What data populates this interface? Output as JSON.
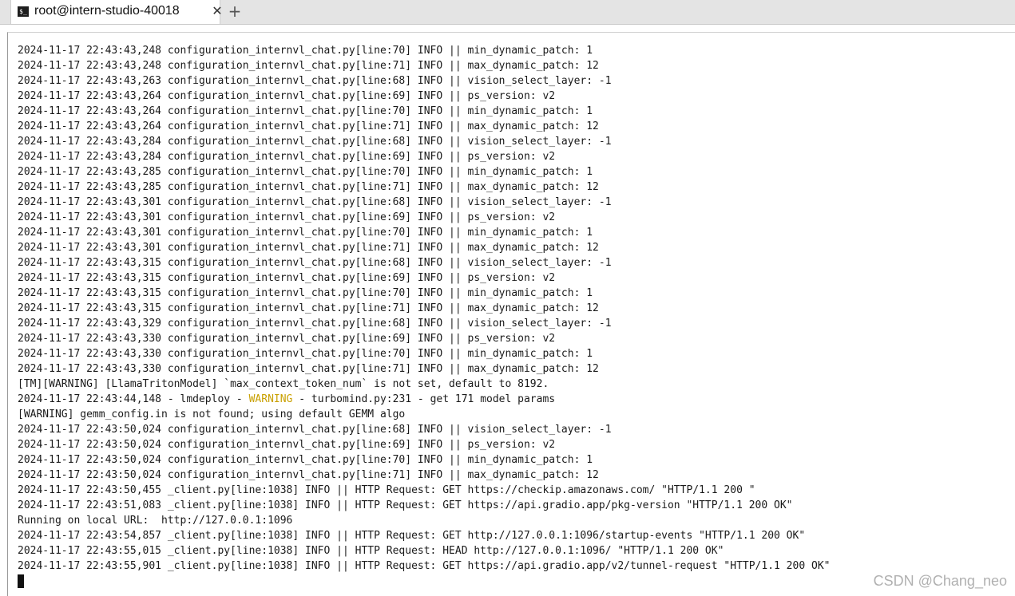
{
  "tab": {
    "icon_text": "$_",
    "title": "root@intern-studio-40018",
    "close_glyph": "✕",
    "new_tab_glyph": "+"
  },
  "colors": {
    "warning": "#c9a000"
  },
  "terminal": {
    "lines": [
      "2024-11-17 22:43:43,248 configuration_internvl_chat.py[line:70] INFO || min_dynamic_patch: 1",
      "2024-11-17 22:43:43,248 configuration_internvl_chat.py[line:71] INFO || max_dynamic_patch: 12",
      "2024-11-17 22:43:43,263 configuration_internvl_chat.py[line:68] INFO || vision_select_layer: -1",
      "2024-11-17 22:43:43,264 configuration_internvl_chat.py[line:69] INFO || ps_version: v2",
      "2024-11-17 22:43:43,264 configuration_internvl_chat.py[line:70] INFO || min_dynamic_patch: 1",
      "2024-11-17 22:43:43,264 configuration_internvl_chat.py[line:71] INFO || max_dynamic_patch: 12",
      "2024-11-17 22:43:43,284 configuration_internvl_chat.py[line:68] INFO || vision_select_layer: -1",
      "2024-11-17 22:43:43,284 configuration_internvl_chat.py[line:69] INFO || ps_version: v2",
      "2024-11-17 22:43:43,285 configuration_internvl_chat.py[line:70] INFO || min_dynamic_patch: 1",
      "2024-11-17 22:43:43,285 configuration_internvl_chat.py[line:71] INFO || max_dynamic_patch: 12",
      "2024-11-17 22:43:43,301 configuration_internvl_chat.py[line:68] INFO || vision_select_layer: -1",
      "2024-11-17 22:43:43,301 configuration_internvl_chat.py[line:69] INFO || ps_version: v2",
      "2024-11-17 22:43:43,301 configuration_internvl_chat.py[line:70] INFO || min_dynamic_patch: 1",
      "2024-11-17 22:43:43,301 configuration_internvl_chat.py[line:71] INFO || max_dynamic_patch: 12",
      "2024-11-17 22:43:43,315 configuration_internvl_chat.py[line:68] INFO || vision_select_layer: -1",
      "2024-11-17 22:43:43,315 configuration_internvl_chat.py[line:69] INFO || ps_version: v2",
      "2024-11-17 22:43:43,315 configuration_internvl_chat.py[line:70] INFO || min_dynamic_patch: 1",
      "2024-11-17 22:43:43,315 configuration_internvl_chat.py[line:71] INFO || max_dynamic_patch: 12",
      "2024-11-17 22:43:43,329 configuration_internvl_chat.py[line:68] INFO || vision_select_layer: -1",
      "2024-11-17 22:43:43,330 configuration_internvl_chat.py[line:69] INFO || ps_version: v2",
      "2024-11-17 22:43:43,330 configuration_internvl_chat.py[line:70] INFO || min_dynamic_patch: 1",
      "2024-11-17 22:43:43,330 configuration_internvl_chat.py[line:71] INFO || max_dynamic_patch: 12",
      "[TM][WARNING] [LlamaTritonModel] `max_context_token_num` is not set, default to 8192."
    ],
    "warning_line": {
      "prefix": "2024-11-17 22:43:44,148 - lmdeploy - ",
      "level": "WARNING",
      "suffix": " - turbomind.py:231 - get 171 model params"
    },
    "lines_after": [
      "[WARNING] gemm_config.in is not found; using default GEMM algo",
      "2024-11-17 22:43:50,024 configuration_internvl_chat.py[line:68] INFO || vision_select_layer: -1",
      "2024-11-17 22:43:50,024 configuration_internvl_chat.py[line:69] INFO || ps_version: v2",
      "2024-11-17 22:43:50,024 configuration_internvl_chat.py[line:70] INFO || min_dynamic_patch: 1",
      "2024-11-17 22:43:50,024 configuration_internvl_chat.py[line:71] INFO || max_dynamic_patch: 12",
      "2024-11-17 22:43:50,455 _client.py[line:1038] INFO || HTTP Request: GET https://checkip.amazonaws.com/ \"HTTP/1.1 200 \"",
      "2024-11-17 22:43:51,083 _client.py[line:1038] INFO || HTTP Request: GET https://api.gradio.app/pkg-version \"HTTP/1.1 200 OK\"",
      "Running on local URL:  http://127.0.0.1:1096",
      "2024-11-17 22:43:54,857 _client.py[line:1038] INFO || HTTP Request: GET http://127.0.0.1:1096/startup-events \"HTTP/1.1 200 OK\"",
      "2024-11-17 22:43:55,015 _client.py[line:1038] INFO || HTTP Request: HEAD http://127.0.0.1:1096/ \"HTTP/1.1 200 OK\"",
      "2024-11-17 22:43:55,901 _client.py[line:1038] INFO || HTTP Request: GET https://api.gradio.app/v2/tunnel-request \"HTTP/1.1 200 OK\""
    ]
  },
  "watermark": "CSDN @Chang_neo"
}
